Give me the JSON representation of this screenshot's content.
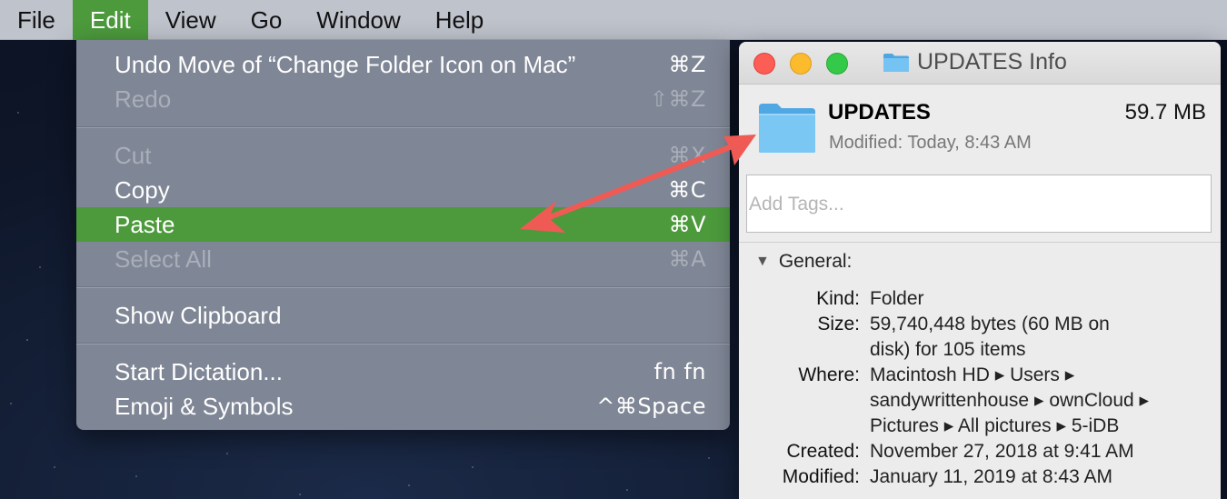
{
  "menubar": {
    "items": [
      {
        "label": "File",
        "active": false
      },
      {
        "label": "Edit",
        "active": true
      },
      {
        "label": "View",
        "active": false
      },
      {
        "label": "Go",
        "active": false
      },
      {
        "label": "Window",
        "active": false
      },
      {
        "label": "Help",
        "active": false
      }
    ]
  },
  "edit_menu": {
    "undo": {
      "label": "Undo Move of “Change Folder Icon on Mac”",
      "shortcut": "⌘Z"
    },
    "redo": {
      "label": "Redo",
      "shortcut": "⇧⌘Z"
    },
    "cut": {
      "label": "Cut",
      "shortcut": "⌘X"
    },
    "copy": {
      "label": "Copy",
      "shortcut": "⌘C"
    },
    "paste": {
      "label": "Paste",
      "shortcut": "⌘V"
    },
    "select_all": {
      "label": "Select All",
      "shortcut": "⌘A"
    },
    "show_clipboard": {
      "label": "Show Clipboard",
      "shortcut": ""
    },
    "start_dictation": {
      "label": "Start Dictation...",
      "shortcut": "fn fn"
    },
    "emoji": {
      "label": "Emoji & Symbols",
      "shortcut": "^⌘Space"
    }
  },
  "info_window": {
    "title": "UPDATES Info",
    "folder_name": "UPDATES",
    "size": "59.7 MB",
    "modified_line": "Modified: Today, 8:43 AM",
    "tags_placeholder": "Add Tags...",
    "section": "General:",
    "details": {
      "kind_label": "Kind:",
      "kind": "Folder",
      "size_label": "Size:",
      "size_line1": "59,740,448 bytes (60 MB on",
      "size_line2": "disk) for 105 items",
      "where_label": "Where:",
      "where_line1": "Macintosh HD ▸ Users ▸",
      "where_line2": "sandywrittenhouse ▸ ownCloud ▸",
      "where_line3": "Pictures ▸ All pictures ▸ 5-iDB",
      "created_label": "Created:",
      "created": "November 27, 2018 at 9:41 AM",
      "modified_label": "Modified:",
      "modified": "January 11, 2019 at 8:43 AM"
    }
  },
  "colors": {
    "highlight": "#4c9a3c",
    "arrow": "#f05a55",
    "folder": "#5fb8ee"
  }
}
